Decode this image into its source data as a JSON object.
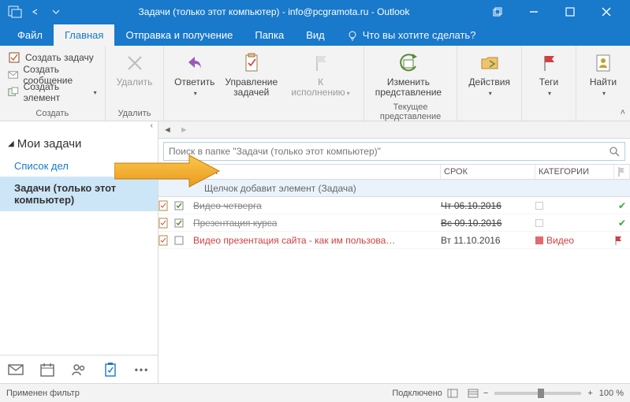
{
  "titlebar": {
    "title": "Задачи (только этот компьютер) - info@pcgramota.ru - Outlook"
  },
  "tabs": {
    "file": "Файл",
    "home": "Главная",
    "sendreceive": "Отправка и получение",
    "folder": "Папка",
    "view": "Вид",
    "tellme": "Что вы хотите сделать?"
  },
  "ribbon": {
    "create": {
      "new_task": "Создать задачу",
      "new_msg": "Создать сообщение",
      "new_items": "Создать элемент",
      "group": "Создать"
    },
    "delete": {
      "btn": "Удалить",
      "group": "Удалить"
    },
    "respond": {
      "reply": "Ответить",
      "group": ""
    },
    "manage": {
      "btn": "Управление\nзадачей",
      "followup": "К исполнению",
      "group": ""
    },
    "view": {
      "change": "Изменить\nпредставление",
      "group": "Текущее представление"
    },
    "actions": {
      "btn": "Действия",
      "group": ""
    },
    "tags": {
      "btn": "Теги",
      "group": ""
    },
    "find": {
      "btn": "Найти",
      "group": ""
    }
  },
  "sidebar": {
    "header": "Мои задачи",
    "todolist": "Список дел",
    "tasks_active": "Задачи (только этот компьютер)"
  },
  "search": {
    "placeholder": "Поиск в папке \"Задачи (только этот компьютер)\""
  },
  "columns": {
    "subject": "ТЕМА",
    "due": "СРОК",
    "cat": "КАТЕГОРИИ"
  },
  "newrow": {
    "text": "Щелчок добавит элемент (Задача)"
  },
  "tasks": [
    {
      "done": true,
      "subject": "Видео четверга",
      "due": "Чт 06.10.2016",
      "cat": "",
      "flag": "done"
    },
    {
      "done": true,
      "subject": "Презентация курса",
      "due": "Вс 09.10.2016",
      "cat": "",
      "flag": "done"
    },
    {
      "done": false,
      "subject": "Видео презентация сайта - как им пользова…",
      "due": "Вт 11.10.2016",
      "cat": "Видео",
      "catcolor": "#E26A6A",
      "flag": "red",
      "overdue": true
    }
  ],
  "status": {
    "filter": "Применен фильтр",
    "conn": "Подключено",
    "zoommin": "−",
    "zoommax": "+",
    "zoom": "100 %"
  }
}
